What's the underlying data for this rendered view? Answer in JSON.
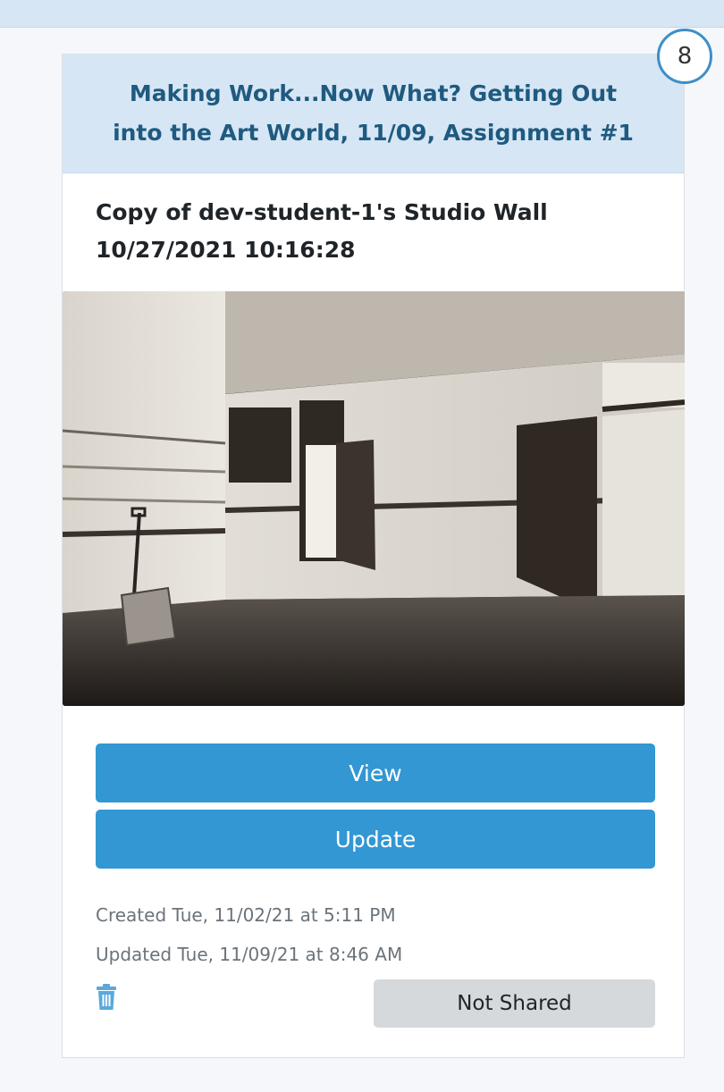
{
  "assignment": {
    "title": "Making Work...Now What? Getting Out into the Art World, 11/09, Assignment #1",
    "count": "8"
  },
  "wall": {
    "title": "Copy of dev-student-1's Studio Wall 10/27/2021 10:16:28",
    "image_description_icon": "studio-photo"
  },
  "actions": {
    "view_label": "View",
    "update_label": "Update"
  },
  "meta": {
    "created": "Created Tue, 11/02/21 at 5:11 PM",
    "updated": "Updated Tue, 11/09/21 at 8:46 AM"
  },
  "footer": {
    "delete_icon": "trash-icon",
    "share_status": "Not Shared"
  },
  "colors": {
    "header_bg": "#d6e6f5",
    "header_text": "#1f5a7f",
    "primary": "#3297d3",
    "badge_border": "#3d8fc6",
    "secondary_bg": "#d6d9dc"
  }
}
